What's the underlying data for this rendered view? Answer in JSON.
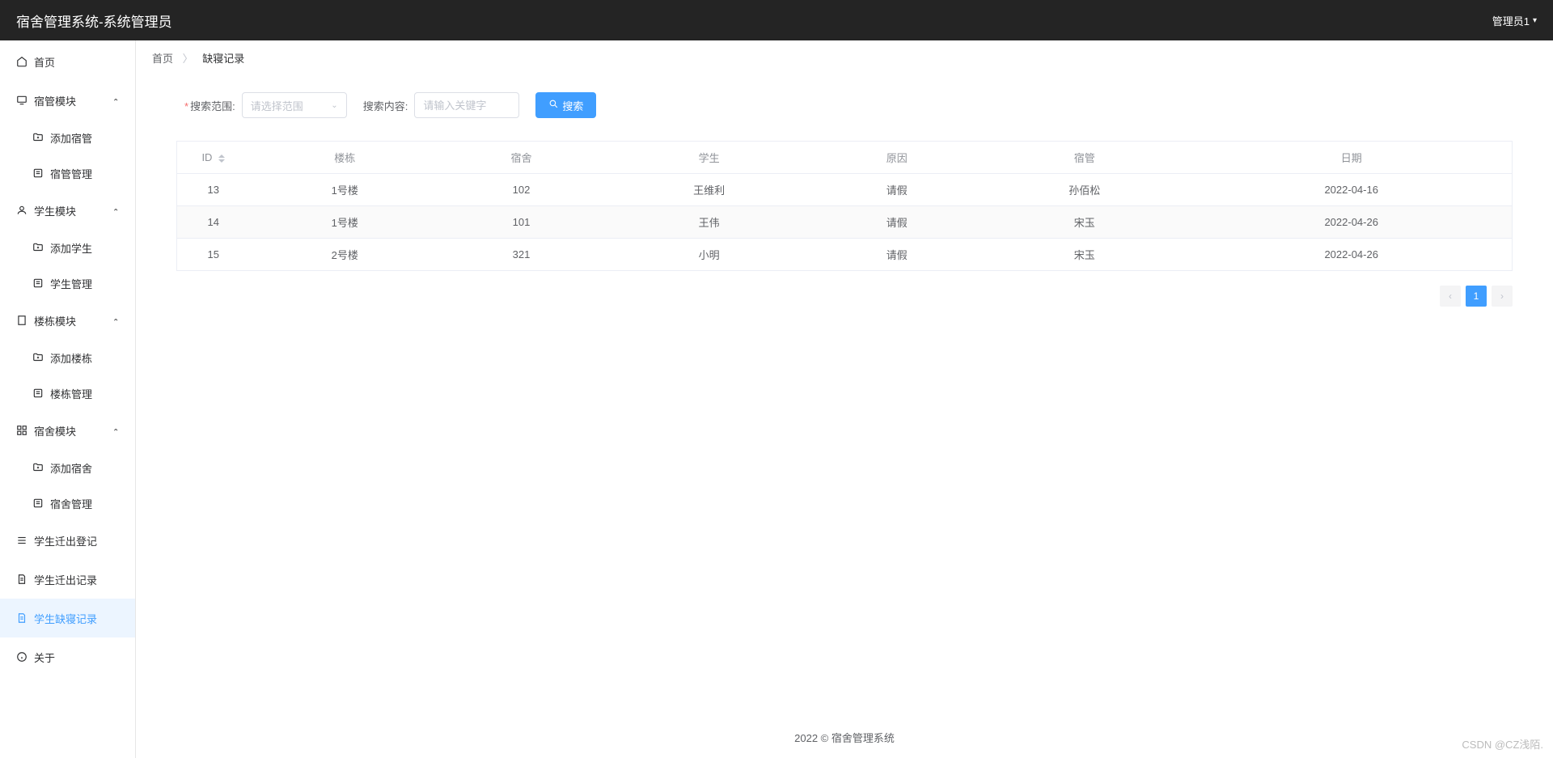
{
  "header": {
    "title": "宿舍管理系统-系统管理员",
    "user": "管理员1"
  },
  "sidebar": {
    "home": "首页",
    "groups": [
      {
        "label": "宿管模块",
        "items": [
          "添加宿管",
          "宿管管理"
        ]
      },
      {
        "label": "学生模块",
        "items": [
          "添加学生",
          "学生管理"
        ]
      },
      {
        "label": "楼栋模块",
        "items": [
          "添加楼栋",
          "楼栋管理"
        ]
      },
      {
        "label": "宿舍模块",
        "items": [
          "添加宿舍",
          "宿舍管理"
        ]
      }
    ],
    "move_reg": "学生迁出登记",
    "move_log": "学生迁出记录",
    "absent_log": "学生缺寝记录",
    "about": "关于"
  },
  "breadcrumb": {
    "home": "首页",
    "current": "缺寝记录"
  },
  "search": {
    "range_label": "搜索范围:",
    "range_placeholder": "请选择范围",
    "content_label": "搜索内容:",
    "content_placeholder": "请输入关键字",
    "button": "搜索"
  },
  "table": {
    "headers": {
      "id": "ID",
      "building": "楼栋",
      "room": "宿舍",
      "student": "学生",
      "reason": "原因",
      "manager": "宿管",
      "date": "日期"
    },
    "rows": [
      {
        "id": "13",
        "building": "1号楼",
        "room": "102",
        "student": "王维利",
        "reason": "请假",
        "manager": "孙佰松",
        "date": "2022-04-16"
      },
      {
        "id": "14",
        "building": "1号楼",
        "room": "101",
        "student": "王伟",
        "reason": "请假",
        "manager": "宋玉",
        "date": "2022-04-26"
      },
      {
        "id": "15",
        "building": "2号楼",
        "room": "321",
        "student": "小明",
        "reason": "请假",
        "manager": "宋玉",
        "date": "2022-04-26"
      }
    ]
  },
  "pagination": {
    "current": "1"
  },
  "footer": "2022 © 宿舍管理系统",
  "watermark": "CSDN @CZ浅陌."
}
